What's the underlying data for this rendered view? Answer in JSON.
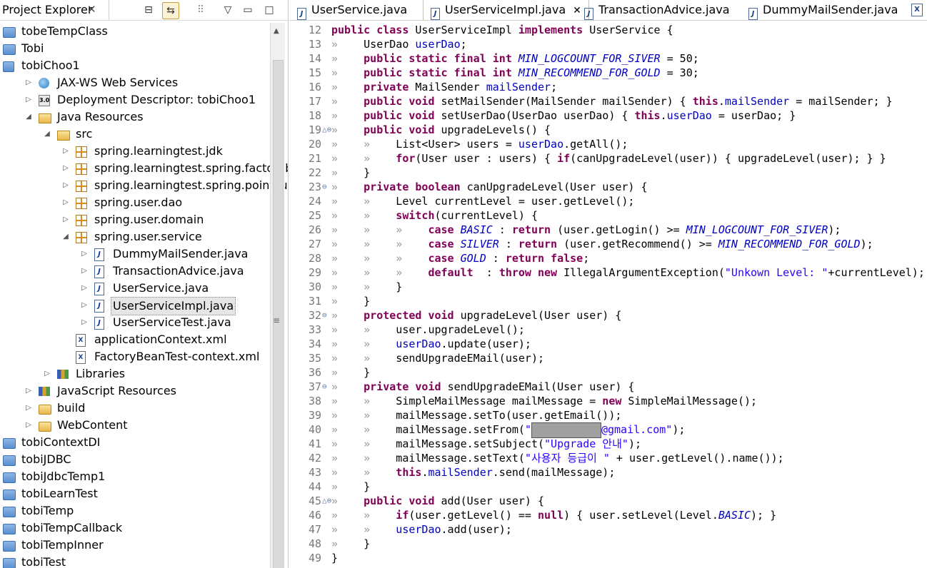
{
  "explorer": {
    "title": "Project Explorer",
    "close": "✕",
    "items": [
      {
        "label": "tobeTempClass",
        "indent": 0,
        "arrow": "",
        "icon": "project-folder-icon"
      },
      {
        "label": "Tobi",
        "indent": 0,
        "arrow": "",
        "icon": "project-folder-icon"
      },
      {
        "label": "tobiChoo1",
        "indent": 0,
        "arrow": "",
        "icon": "web-project-icon"
      },
      {
        "label": "JAX-WS Web Services",
        "indent": 1,
        "arrow": "▷",
        "icon": "globe-icon"
      },
      {
        "label": "Deployment Descriptor: tobiChoo1",
        "indent": 1,
        "arrow": "▷",
        "icon": "descriptor-icon"
      },
      {
        "label": "Java Resources",
        "indent": 1,
        "arrow": "◢",
        "icon": "java-resources-icon"
      },
      {
        "label": "src",
        "indent": 2,
        "arrow": "◢",
        "icon": "source-folder-icon"
      },
      {
        "label": "spring.learningtest.jdk",
        "indent": 3,
        "arrow": "▷",
        "icon": "package-icon"
      },
      {
        "label": "spring.learningtest.spring.factorybean",
        "indent": 3,
        "arrow": "▷",
        "icon": "package-icon"
      },
      {
        "label": "spring.learningtest.spring.pointcut",
        "indent": 3,
        "arrow": "▷",
        "icon": "package-icon"
      },
      {
        "label": "spring.user.dao",
        "indent": 3,
        "arrow": "▷",
        "icon": "package-icon"
      },
      {
        "label": "spring.user.domain",
        "indent": 3,
        "arrow": "▷",
        "icon": "package-icon"
      },
      {
        "label": "spring.user.service",
        "indent": 3,
        "arrow": "◢",
        "icon": "package-icon"
      },
      {
        "label": "DummyMailSender.java",
        "indent": 4,
        "arrow": "▷",
        "icon": "java-file-icon"
      },
      {
        "label": "TransactionAdvice.java",
        "indent": 4,
        "arrow": "▷",
        "icon": "java-file-icon"
      },
      {
        "label": "UserService.java",
        "indent": 4,
        "arrow": "▷",
        "icon": "java-file-icon"
      },
      {
        "label": "UserServiceImpl.java",
        "indent": 4,
        "arrow": "▷",
        "icon": "java-file-icon",
        "selected": true
      },
      {
        "label": "UserServiceTest.java",
        "indent": 4,
        "arrow": "▷",
        "icon": "java-file-icon"
      },
      {
        "label": "applicationContext.xml",
        "indent": 3,
        "arrow": "",
        "icon": "xml-file-icon"
      },
      {
        "label": "FactoryBeanTest-context.xml",
        "indent": 3,
        "arrow": "",
        "icon": "xml-file-icon"
      },
      {
        "label": "Libraries",
        "indent": 2,
        "arrow": "▷",
        "icon": "libraries-icon"
      },
      {
        "label": "JavaScript Resources",
        "indent": 1,
        "arrow": "▷",
        "icon": "libraries-icon"
      },
      {
        "label": "build",
        "indent": 1,
        "arrow": "▷",
        "icon": "folder-icon"
      },
      {
        "label": "WebContent",
        "indent": 1,
        "arrow": "▷",
        "icon": "folder-icon"
      },
      {
        "label": "tobiContextDI",
        "indent": 0,
        "arrow": "",
        "icon": "project-folder-icon"
      },
      {
        "label": "tobiJDBC",
        "indent": 0,
        "arrow": "",
        "icon": "project-folder-icon"
      },
      {
        "label": "tobiJdbcTemp1",
        "indent": 0,
        "arrow": "",
        "icon": "project-folder-icon"
      },
      {
        "label": "tobiLearnTest",
        "indent": 0,
        "arrow": "",
        "icon": "project-folder-icon"
      },
      {
        "label": "tobiTemp",
        "indent": 0,
        "arrow": "",
        "icon": "project-folder-icon"
      },
      {
        "label": "tobiTempCallback",
        "indent": 0,
        "arrow": "",
        "icon": "project-folder-icon"
      },
      {
        "label": "tobiTempInner",
        "indent": 0,
        "arrow": "",
        "icon": "project-folder-icon"
      },
      {
        "label": "tobiTest",
        "indent": 0,
        "arrow": "",
        "icon": "project-folder-icon"
      }
    ]
  },
  "editor_tabs": [
    {
      "label": "UserService.java",
      "active": false
    },
    {
      "label": "UserServiceImpl.java",
      "active": true,
      "close": "✕"
    },
    {
      "label": "TransactionAdvice.java",
      "active": false
    },
    {
      "label": "DummyMailSender.java",
      "active": false
    }
  ],
  "code_lines": [
    {
      "n": "12",
      "m": "",
      "t": [
        [
          "k",
          "public class "
        ],
        [
          "",
          "UserServiceImpl "
        ],
        [
          "k",
          "implements "
        ],
        [
          "",
          "UserService {"
        ]
      ]
    },
    {
      "n": "13",
      "m": "",
      "t": [
        [
          "w",
          "» "
        ],
        [
          "",
          "   UserDao "
        ],
        [
          "f",
          "userDao"
        ],
        [
          "",
          ";"
        ]
      ]
    },
    {
      "n": "14",
      "m": "",
      "t": [
        [
          "w",
          "» "
        ],
        [
          "k",
          "   public static final int "
        ],
        [
          "sf",
          "MIN_LOGCOUNT_FOR_SIVER"
        ],
        [
          "",
          " = 50;"
        ]
      ]
    },
    {
      "n": "15",
      "m": "",
      "t": [
        [
          "w",
          "» "
        ],
        [
          "k",
          "   public static final int "
        ],
        [
          "sf",
          "MIN_RECOMMEND_FOR_GOLD"
        ],
        [
          "",
          " = 30;"
        ]
      ]
    },
    {
      "n": "16",
      "m": "",
      "t": [
        [
          "w",
          "» "
        ],
        [
          "k",
          "   private "
        ],
        [
          "",
          "MailSender "
        ],
        [
          "f",
          "mailSender"
        ],
        [
          "",
          ";"
        ]
      ]
    },
    {
      "n": "17",
      "m": "",
      "t": [
        [
          "w",
          "» "
        ],
        [
          "k",
          "   public void "
        ],
        [
          "",
          "setMailSender(MailSender mailSender) { "
        ],
        [
          "k",
          "this"
        ],
        [
          "",
          "."
        ],
        [
          "f",
          "mailSender"
        ],
        [
          "",
          " = mailSender; }"
        ]
      ]
    },
    {
      "n": "18",
      "m": "",
      "t": [
        [
          "w",
          "» "
        ],
        [
          "k",
          "   public void "
        ],
        [
          "",
          "setUserDao(UserDao userDao) { "
        ],
        [
          "k",
          "this"
        ],
        [
          "",
          "."
        ],
        [
          "f",
          "userDao"
        ],
        [
          "",
          " = userDao; }"
        ]
      ]
    },
    {
      "n": "19",
      "m": "△⊖",
      "t": [
        [
          "w",
          "» "
        ],
        [
          "k",
          "   public void "
        ],
        [
          "",
          "upgradeLevels() {"
        ]
      ]
    },
    {
      "n": "20",
      "m": "",
      "t": [
        [
          "w",
          "» "
        ],
        [
          "w",
          "   » "
        ],
        [
          "",
          "   List<User> users = "
        ],
        [
          "f",
          "userDao"
        ],
        [
          "",
          ".getAll();"
        ]
      ]
    },
    {
      "n": "21",
      "m": "",
      "t": [
        [
          "w",
          "» "
        ],
        [
          "w",
          "   » "
        ],
        [
          "k",
          "   for"
        ],
        [
          "",
          "(User user : users) { "
        ],
        [
          "k",
          "if"
        ],
        [
          "",
          "(canUpgradeLevel(user)) { upgradeLevel(user); } }"
        ]
      ]
    },
    {
      "n": "22",
      "m": "",
      "t": [
        [
          "w",
          "» "
        ],
        [
          "",
          "   }"
        ]
      ]
    },
    {
      "n": "23",
      "m": "⊖",
      "t": [
        [
          "w",
          "» "
        ],
        [
          "k",
          "   private boolean "
        ],
        [
          "",
          "canUpgradeLevel(User user) {"
        ]
      ]
    },
    {
      "n": "24",
      "m": "",
      "t": [
        [
          "w",
          "» "
        ],
        [
          "w",
          "   » "
        ],
        [
          "",
          "   Level currentLevel = user.getLevel();"
        ]
      ]
    },
    {
      "n": "25",
      "m": "",
      "t": [
        [
          "w",
          "» "
        ],
        [
          "w",
          "   » "
        ],
        [
          "k",
          "   switch"
        ],
        [
          "",
          "(currentLevel) {"
        ]
      ]
    },
    {
      "n": "26",
      "m": "",
      "t": [
        [
          "w",
          "» "
        ],
        [
          "w",
          "   » "
        ],
        [
          "w",
          "   » "
        ],
        [
          "k",
          "   case "
        ],
        [
          "sf",
          "BASIC"
        ],
        [
          "",
          " : "
        ],
        [
          "k",
          "return "
        ],
        [
          "",
          "(user.getLogin() >= "
        ],
        [
          "sf",
          "MIN_LOGCOUNT_FOR_SIVER"
        ],
        [
          "",
          ");"
        ]
      ]
    },
    {
      "n": "27",
      "m": "",
      "t": [
        [
          "w",
          "» "
        ],
        [
          "w",
          "   » "
        ],
        [
          "w",
          "   » "
        ],
        [
          "k",
          "   case "
        ],
        [
          "sf",
          "SILVER"
        ],
        [
          "",
          " : "
        ],
        [
          "k",
          "return "
        ],
        [
          "",
          "(user.getRecommend() >= "
        ],
        [
          "sf",
          "MIN_RECOMMEND_FOR_GOLD"
        ],
        [
          "",
          ");"
        ]
      ]
    },
    {
      "n": "28",
      "m": "",
      "t": [
        [
          "w",
          "» "
        ],
        [
          "w",
          "   » "
        ],
        [
          "w",
          "   » "
        ],
        [
          "k",
          "   case "
        ],
        [
          "sf",
          "GOLD"
        ],
        [
          "",
          " : "
        ],
        [
          "k",
          "return false"
        ],
        [
          "",
          ";"
        ]
      ]
    },
    {
      "n": "29",
      "m": "",
      "t": [
        [
          "w",
          "» "
        ],
        [
          "w",
          "   » "
        ],
        [
          "w",
          "   » "
        ],
        [
          "k",
          "   default "
        ],
        [
          "",
          " : "
        ],
        [
          "k",
          "throw new "
        ],
        [
          "",
          "IllegalArgumentException("
        ],
        [
          "s",
          "\"Unkown Level: \""
        ],
        [
          "",
          "+currentLevel);"
        ]
      ]
    },
    {
      "n": "30",
      "m": "",
      "t": [
        [
          "w",
          "» "
        ],
        [
          "w",
          "   » "
        ],
        [
          "",
          "   }"
        ]
      ]
    },
    {
      "n": "31",
      "m": "",
      "t": [
        [
          "w",
          "» "
        ],
        [
          "",
          "   }"
        ]
      ]
    },
    {
      "n": "32",
      "m": "⊖",
      "t": [
        [
          "w",
          "» "
        ],
        [
          "k",
          "   protected void "
        ],
        [
          "",
          "upgradeLevel(User user) {"
        ]
      ]
    },
    {
      "n": "33",
      "m": "",
      "t": [
        [
          "w",
          "» "
        ],
        [
          "w",
          "   » "
        ],
        [
          "",
          "   user.upgradeLevel();"
        ]
      ]
    },
    {
      "n": "34",
      "m": "",
      "t": [
        [
          "w",
          "» "
        ],
        [
          "w",
          "   » "
        ],
        [
          "f",
          "   userDao"
        ],
        [
          "",
          ".update(user);"
        ]
      ]
    },
    {
      "n": "35",
      "m": "",
      "t": [
        [
          "w",
          "» "
        ],
        [
          "w",
          "   » "
        ],
        [
          "",
          "   sendUpgradeEMail(user);"
        ]
      ]
    },
    {
      "n": "36",
      "m": "",
      "t": [
        [
          "w",
          "» "
        ],
        [
          "",
          "   }"
        ]
      ]
    },
    {
      "n": "37",
      "m": "⊖",
      "t": [
        [
          "w",
          "» "
        ],
        [
          "k",
          "   private void "
        ],
        [
          "",
          "sendUpgradeEMail(User user) {"
        ]
      ]
    },
    {
      "n": "38",
      "m": "",
      "t": [
        [
          "w",
          "» "
        ],
        [
          "w",
          "   » "
        ],
        [
          "",
          "   SimpleMailMessage mailMessage = "
        ],
        [
          "k",
          "new "
        ],
        [
          "",
          "SimpleMailMessage();"
        ]
      ]
    },
    {
      "n": "39",
      "m": "",
      "t": [
        [
          "w",
          "» "
        ],
        [
          "w",
          "   » "
        ],
        [
          "",
          "   mailMessage.setTo(user.getEmail());"
        ]
      ]
    },
    {
      "n": "40",
      "m": "",
      "t": [
        [
          "w",
          "» "
        ],
        [
          "w",
          "   » "
        ],
        [
          "",
          "   mailMessage.setFrom("
        ],
        [
          "s",
          "\""
        ],
        [
          "redact",
          ""
        ],
        [
          "s",
          "@gmail.com\""
        ],
        [
          "",
          ");"
        ]
      ]
    },
    {
      "n": "41",
      "m": "",
      "t": [
        [
          "w",
          "» "
        ],
        [
          "w",
          "   » "
        ],
        [
          "",
          "   mailMessage.setSubject("
        ],
        [
          "s",
          "\"Upgrade 안내\""
        ],
        [
          "",
          ");"
        ]
      ]
    },
    {
      "n": "42",
      "m": "",
      "t": [
        [
          "w",
          "» "
        ],
        [
          "w",
          "   » "
        ],
        [
          "",
          "   mailMessage.setText("
        ],
        [
          "s",
          "\"사용자 등급이 \""
        ],
        [
          "",
          " + user.getLevel().name());"
        ]
      ]
    },
    {
      "n": "43",
      "m": "",
      "t": [
        [
          "w",
          "» "
        ],
        [
          "w",
          "   » "
        ],
        [
          "k",
          "   this"
        ],
        [
          "",
          "."
        ],
        [
          "f",
          "mailSender"
        ],
        [
          "",
          ".send(mailMessage);"
        ]
      ]
    },
    {
      "n": "44",
      "m": "",
      "t": [
        [
          "w",
          "» "
        ],
        [
          "",
          "   }"
        ]
      ]
    },
    {
      "n": "45",
      "m": "△⊖",
      "t": [
        [
          "w",
          "» "
        ],
        [
          "k",
          "   public void "
        ],
        [
          "",
          "add(User user) {"
        ]
      ]
    },
    {
      "n": "46",
      "m": "",
      "t": [
        [
          "w",
          "» "
        ],
        [
          "w",
          "   » "
        ],
        [
          "k",
          "   if"
        ],
        [
          "",
          "(user.getLevel() == "
        ],
        [
          "k",
          "null"
        ],
        [
          "",
          ") { user.setLevel(Level."
        ],
        [
          "sf",
          "BASIC"
        ],
        [
          "",
          "); }"
        ]
      ]
    },
    {
      "n": "47",
      "m": "",
      "t": [
        [
          "w",
          "» "
        ],
        [
          "w",
          "   » "
        ],
        [
          "f",
          "   userDao"
        ],
        [
          "",
          ".add(user);"
        ]
      ]
    },
    {
      "n": "48",
      "m": "",
      "t": [
        [
          "w",
          "» "
        ],
        [
          "",
          "   }"
        ]
      ]
    },
    {
      "n": "49",
      "m": "",
      "t": [
        [
          "",
          "}"
        ]
      ]
    }
  ]
}
